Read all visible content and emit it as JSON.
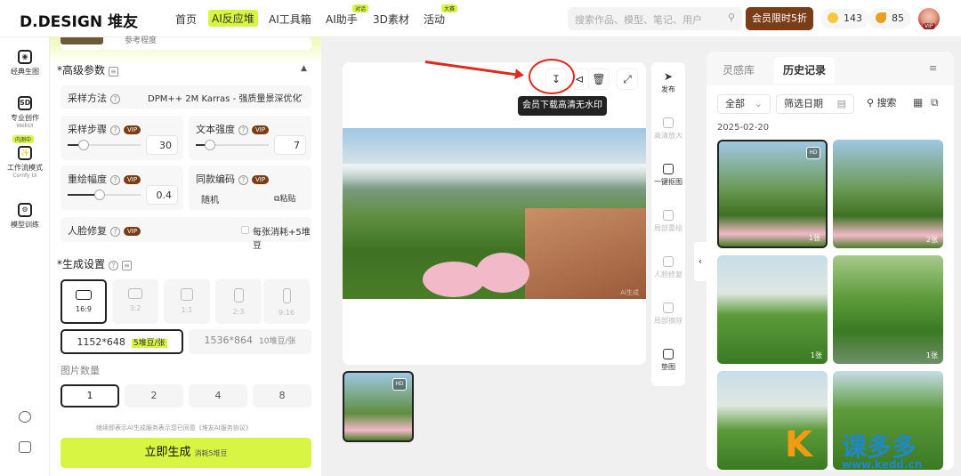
{
  "topbar": {
    "logo": "D.DESIGN 堆友",
    "nav": [
      {
        "label": "首页"
      },
      {
        "label": "AI反应堆"
      },
      {
        "label": "AI工具箱"
      },
      {
        "label": "AI助手",
        "tag": "对话"
      },
      {
        "label": "3D素材"
      },
      {
        "label": "活动",
        "tag": "大赛"
      }
    ],
    "search_placeholder": "搜索作品、模型、笔记、用户",
    "vip_button": "会员限时5折",
    "coins": "143",
    "beans": "85",
    "avatar_badge": "VIP"
  },
  "leftnav": [
    {
      "label": "经典生图",
      "icon": "classic-gen-icon"
    },
    {
      "label": "专业创作",
      "sub": "WebUI",
      "icon": "pro-create-icon"
    },
    {
      "label": "工作流模式",
      "sub": "Comfy UI",
      "badge": "内测中",
      "icon": "workflow-icon"
    },
    {
      "label": "模型训练",
      "icon": "model-train-icon"
    }
  ],
  "panel": {
    "prev_row_label": "参考程度",
    "advanced_title": "高级参数",
    "sampler_label": "采样方法",
    "sampler_value": "DPM++ 2M Karras - 强质量景深优化",
    "steps_label": "采样步骤",
    "steps_value": "30",
    "text_strength_label": "文本强度",
    "text_strength_value": "7",
    "redraw_label": "重绘幅度",
    "redraw_value": "0.4",
    "seed_label": "同款编码",
    "seed_value": "随机",
    "paste_label": "粘贴",
    "face_label": "人脸修复",
    "face_cost": "每张消耗+5堆豆",
    "vip_tag": "VIP",
    "gen_settings_title": "生成设置",
    "ratios": [
      "16:9",
      "3:2",
      "1:1",
      "2:3",
      "9:16"
    ],
    "sizes": [
      {
        "res": "1152*648",
        "cost": "5堆豆/张"
      },
      {
        "res": "1536*864",
        "cost": "10堆豆/张"
      }
    ],
    "count_label": "图片数量",
    "counts": [
      "1",
      "2",
      "4",
      "8"
    ],
    "agreement": "继续即表示AI生成服务表示您已同意《堆友AI服务协议》",
    "generate_label": "立即生成",
    "generate_cost": "消耗5堆豆"
  },
  "canvas": {
    "tooltip": "会员下载高清无水印",
    "image_watermark": "Ai生成",
    "thumb_badge": "HD"
  },
  "sidetools": [
    {
      "label": "发布",
      "enabled": true
    },
    {
      "label": "高清放大",
      "enabled": false
    },
    {
      "label": "一键抠图",
      "enabled": true
    },
    {
      "label": "局部重绘",
      "enabled": false
    },
    {
      "label": "人脸修复",
      "enabled": false
    },
    {
      "label": "局部擦除",
      "enabled": false
    },
    {
      "label": "垫图",
      "enabled": true
    }
  ],
  "history": {
    "tabs": [
      "灵感库",
      "历史记录"
    ],
    "filter_all": "全部",
    "filter_date": "筛选日期",
    "search": "搜索",
    "date": "2025-02-20",
    "items": [
      {
        "count": "1张",
        "hd": "HD"
      },
      {
        "count": "2张"
      },
      {
        "count": "1张"
      },
      {
        "count": "1张"
      },
      {
        "count": ""
      },
      {
        "count": ""
      }
    ]
  },
  "watermark": {
    "brand": "课多多",
    "url": "www.kedd.cn"
  }
}
